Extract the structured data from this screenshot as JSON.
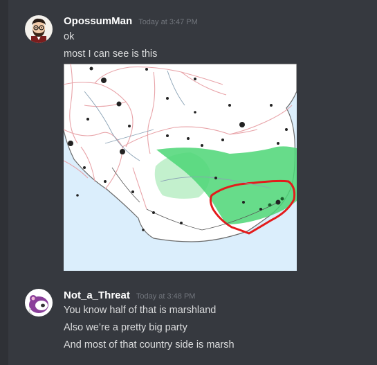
{
  "messages": [
    {
      "author": "OpossumMan",
      "timestamp": "Today at 3:47 PM",
      "avatar_icon": "bearded-man-avatar-icon",
      "lines": [
        "ok",
        "most I can see is this"
      ],
      "attachment": {
        "type": "image",
        "content": "map-with-green-region-and-red-circled-area",
        "colors": {
          "sea": "#dbeefc",
          "land": "#ffffff",
          "region": "#4cd675",
          "circle": "#e31b1b",
          "roads": "#e8a3a8"
        }
      }
    },
    {
      "author": "Not_a_Threat",
      "timestamp": "Today at 3:48 PM",
      "avatar_icon": "purple-opossum-avatar-icon",
      "lines": [
        "You know half of that is marshland",
        "Also we’re a pretty big party",
        "And most of that country side is marsh"
      ]
    }
  ],
  "colors": {
    "background": "#36393f",
    "username": "#ffffff",
    "text": "#dcddde",
    "timestamp": "#72767d"
  }
}
